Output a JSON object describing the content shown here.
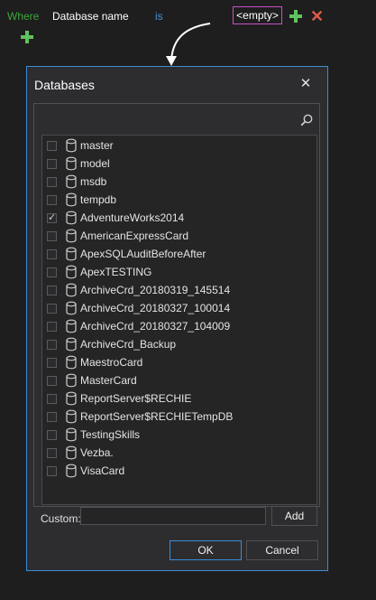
{
  "filter": {
    "where": "Where",
    "field": "Database name",
    "operator": "is",
    "value": "<empty>"
  },
  "dialog": {
    "title": "Databases",
    "close": "✕",
    "custom_label": "Custom:",
    "custom_value": "",
    "add_label": "Add",
    "ok_label": "OK",
    "cancel_label": "Cancel",
    "items": [
      {
        "label": "master",
        "checked": false
      },
      {
        "label": "model",
        "checked": false
      },
      {
        "label": "msdb",
        "checked": false
      },
      {
        "label": "tempdb",
        "checked": false
      },
      {
        "label": "AdventureWorks2014",
        "checked": true
      },
      {
        "label": "AmericanExpressCard",
        "checked": false
      },
      {
        "label": "ApexSQLAuditBeforeAfter",
        "checked": false
      },
      {
        "label": "ApexTESTING",
        "checked": false
      },
      {
        "label": "ArchiveCrd_20180319_145514",
        "checked": false
      },
      {
        "label": "ArchiveCrd_20180327_100014",
        "checked": false
      },
      {
        "label": "ArchiveCrd_20180327_104009",
        "checked": false
      },
      {
        "label": "ArchiveCrd_Backup",
        "checked": false
      },
      {
        "label": "MaestroCard",
        "checked": false
      },
      {
        "label": "MasterCard",
        "checked": false
      },
      {
        "label": "ReportServer$RECHIE",
        "checked": false
      },
      {
        "label": "ReportServer$RECHIETempDB",
        "checked": false
      },
      {
        "label": "TestingSkills",
        "checked": false
      },
      {
        "label": "Vezba.",
        "checked": false
      },
      {
        "label": "VisaCard",
        "checked": false
      }
    ]
  },
  "icons": {
    "add": "plus-icon",
    "remove": "close-icon",
    "search": "search-icon",
    "database": "database-icon",
    "check": "✓"
  },
  "colors": {
    "where": "#3aa63a",
    "operator": "#4f8fd8",
    "value_border": "#c850c8",
    "accent": "#3c8cd6",
    "remove": "#e05a4a",
    "add": "#5fc35f"
  }
}
